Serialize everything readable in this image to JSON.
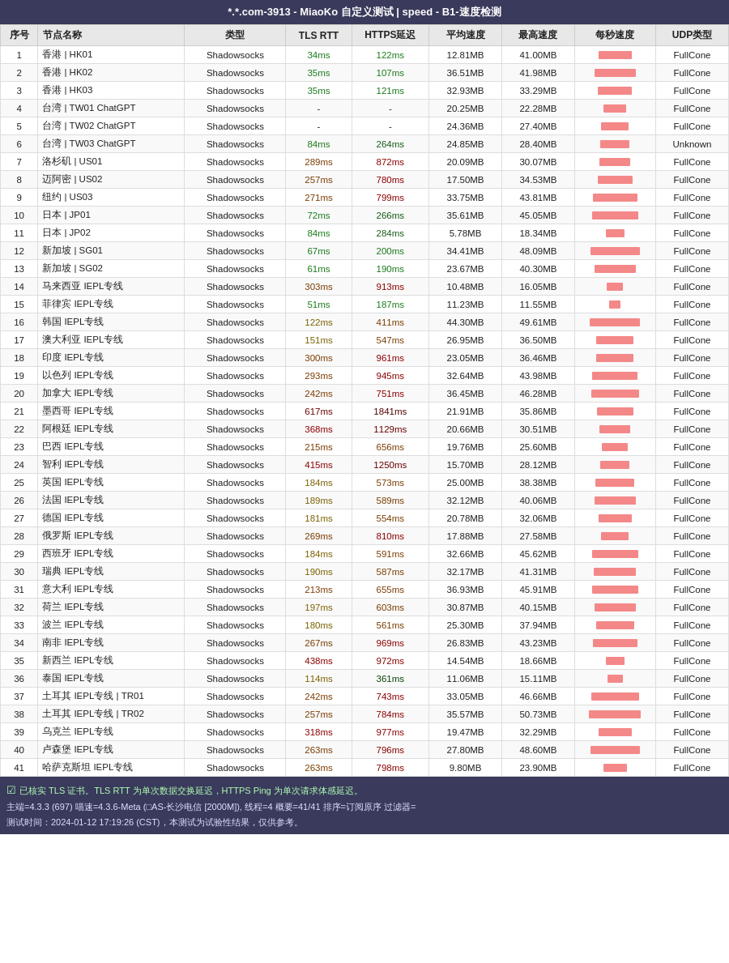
{
  "title": "*.*.com-3913 - MiaoKo 自定义测试 | speed - B1-速度检测",
  "columns": [
    "序号",
    "节点名称",
    "类型",
    "TLS RTT",
    "HTTPS延迟",
    "平均速度",
    "最高速度",
    "每秒速度",
    "UDP类型"
  ],
  "rows": [
    {
      "seq": 1,
      "name": "香港 | HK01",
      "type": "Shadowsocks",
      "tls": "34ms",
      "https": "122ms",
      "avg": "12.81MB",
      "max": "41.00MB",
      "udp": "FullCone",
      "bar": 32,
      "tls_cls": "green-light",
      "https_cls": "green-light"
    },
    {
      "seq": 2,
      "name": "香港 | HK02",
      "type": "Shadowsocks",
      "tls": "35ms",
      "https": "107ms",
      "avg": "36.51MB",
      "max": "41.98MB",
      "udp": "FullCone",
      "bar": 40,
      "tls_cls": "green-light",
      "https_cls": "green-light"
    },
    {
      "seq": 3,
      "name": "香港 | HK03",
      "type": "Shadowsocks",
      "tls": "35ms",
      "https": "121ms",
      "avg": "32.93MB",
      "max": "33.29MB",
      "udp": "FullCone",
      "bar": 33,
      "tls_cls": "green-light",
      "https_cls": "green-light"
    },
    {
      "seq": 4,
      "name": "台湾 | TW01 ChatGPT",
      "type": "Shadowsocks",
      "tls": "-",
      "https": "-",
      "avg": "20.25MB",
      "max": "22.28MB",
      "udp": "FullCone",
      "bar": 22,
      "tls_cls": "",
      "https_cls": ""
    },
    {
      "seq": 5,
      "name": "台湾 | TW02 ChatGPT",
      "type": "Shadowsocks",
      "tls": "-",
      "https": "-",
      "avg": "24.36MB",
      "max": "27.40MB",
      "udp": "FullCone",
      "bar": 27,
      "tls_cls": "",
      "https_cls": ""
    },
    {
      "seq": 6,
      "name": "台湾 | TW03 ChatGPT",
      "type": "Shadowsocks",
      "tls": "84ms",
      "https": "264ms",
      "avg": "24.85MB",
      "max": "28.40MB",
      "udp": "Unknown",
      "bar": 28,
      "tls_cls": "green-light",
      "https_cls": "green-med"
    },
    {
      "seq": 7,
      "name": "洛杉矶 | US01",
      "type": "Shadowsocks",
      "tls": "289ms",
      "https": "872ms",
      "avg": "20.09MB",
      "max": "30.07MB",
      "udp": "FullCone",
      "bar": 30,
      "tls_cls": "orange",
      "https_cls": "red-light"
    },
    {
      "seq": 8,
      "name": "迈阿密 | US02",
      "type": "Shadowsocks",
      "tls": "257ms",
      "https": "780ms",
      "avg": "17.50MB",
      "max": "34.53MB",
      "udp": "FullCone",
      "bar": 34,
      "tls_cls": "orange",
      "https_cls": "red-light"
    },
    {
      "seq": 9,
      "name": "纽约 | US03",
      "type": "Shadowsocks",
      "tls": "271ms",
      "https": "799ms",
      "avg": "33.75MB",
      "max": "43.81MB",
      "udp": "FullCone",
      "bar": 43,
      "tls_cls": "orange",
      "https_cls": "red-light"
    },
    {
      "seq": 10,
      "name": "日本 | JP01",
      "type": "Shadowsocks",
      "tls": "72ms",
      "https": "266ms",
      "avg": "35.61MB",
      "max": "45.05MB",
      "udp": "FullCone",
      "bar": 45,
      "tls_cls": "green-light",
      "https_cls": "green-med"
    },
    {
      "seq": 11,
      "name": "日本 | JP02",
      "type": "Shadowsocks",
      "tls": "84ms",
      "https": "284ms",
      "avg": "5.78MB",
      "max": "18.34MB",
      "udp": "FullCone",
      "bar": 18,
      "tls_cls": "green-light",
      "https_cls": "green-med"
    },
    {
      "seq": 12,
      "name": "新加坡 | SG01",
      "type": "Shadowsocks",
      "tls": "67ms",
      "https": "200ms",
      "avg": "34.41MB",
      "max": "48.09MB",
      "udp": "FullCone",
      "bar": 48,
      "tls_cls": "green-light",
      "https_cls": "green-light"
    },
    {
      "seq": 13,
      "name": "新加坡 | SG02",
      "type": "Shadowsocks",
      "tls": "61ms",
      "https": "190ms",
      "avg": "23.67MB",
      "max": "40.30MB",
      "udp": "FullCone",
      "bar": 40,
      "tls_cls": "green-light",
      "https_cls": "green-light"
    },
    {
      "seq": 14,
      "name": "马来西亚 IEPL专线",
      "type": "Shadowsocks",
      "tls": "303ms",
      "https": "913ms",
      "avg": "10.48MB",
      "max": "16.05MB",
      "udp": "FullCone",
      "bar": 16,
      "tls_cls": "orange",
      "https_cls": "red-light"
    },
    {
      "seq": 15,
      "name": "菲律宾 IEPL专线",
      "type": "Shadowsocks",
      "tls": "51ms",
      "https": "187ms",
      "avg": "11.23MB",
      "max": "11.55MB",
      "udp": "FullCone",
      "bar": 11,
      "tls_cls": "green-light",
      "https_cls": "green-light"
    },
    {
      "seq": 16,
      "name": "韩国 IEPL专线",
      "type": "Shadowsocks",
      "tls": "122ms",
      "https": "411ms",
      "avg": "44.30MB",
      "max": "49.61MB",
      "udp": "FullCone",
      "bar": 49,
      "tls_cls": "yellow-light",
      "https_cls": "orange"
    },
    {
      "seq": 17,
      "name": "澳大利亚 IEPL专线",
      "type": "Shadowsocks",
      "tls": "151ms",
      "https": "547ms",
      "avg": "26.95MB",
      "max": "36.50MB",
      "udp": "FullCone",
      "bar": 36,
      "tls_cls": "yellow-light",
      "https_cls": "orange"
    },
    {
      "seq": 18,
      "name": "印度 IEPL专线",
      "type": "Shadowsocks",
      "tls": "300ms",
      "https": "961ms",
      "avg": "23.05MB",
      "max": "36.46MB",
      "udp": "FullCone",
      "bar": 36,
      "tls_cls": "orange",
      "https_cls": "red-light"
    },
    {
      "seq": 19,
      "name": "以色列 IEPL专线",
      "type": "Shadowsocks",
      "tls": "293ms",
      "https": "945ms",
      "avg": "32.64MB",
      "max": "43.98MB",
      "udp": "FullCone",
      "bar": 44,
      "tls_cls": "orange",
      "https_cls": "red-light"
    },
    {
      "seq": 20,
      "name": "加拿大 IEPL专线",
      "type": "Shadowsocks",
      "tls": "242ms",
      "https": "751ms",
      "avg": "36.45MB",
      "max": "46.28MB",
      "udp": "FullCone",
      "bar": 46,
      "tls_cls": "orange",
      "https_cls": "red-light"
    },
    {
      "seq": 21,
      "name": "墨西哥 IEPL专线",
      "type": "Shadowsocks",
      "tls": "617ms",
      "https": "1841ms",
      "avg": "21.91MB",
      "max": "35.86MB",
      "udp": "FullCone",
      "bar": 35,
      "tls_cls": "red-med",
      "https_cls": "red-dark"
    },
    {
      "seq": 22,
      "name": "阿根廷 IEPL专线",
      "type": "Shadowsocks",
      "tls": "368ms",
      "https": "1129ms",
      "avg": "20.66MB",
      "max": "30.51MB",
      "udp": "FullCone",
      "bar": 30,
      "tls_cls": "red-light",
      "https_cls": "red-med"
    },
    {
      "seq": 23,
      "name": "巴西 IEPL专线",
      "type": "Shadowsocks",
      "tls": "215ms",
      "https": "656ms",
      "avg": "19.76MB",
      "max": "25.60MB",
      "udp": "FullCone",
      "bar": 25,
      "tls_cls": "orange",
      "https_cls": "orange"
    },
    {
      "seq": 24,
      "name": "智利 IEPL专线",
      "type": "Shadowsocks",
      "tls": "415ms",
      "https": "1250ms",
      "avg": "15.70MB",
      "max": "28.12MB",
      "udp": "FullCone",
      "bar": 28,
      "tls_cls": "red-light",
      "https_cls": "red-med"
    },
    {
      "seq": 25,
      "name": "英国 IEPL专线",
      "type": "Shadowsocks",
      "tls": "184ms",
      "https": "573ms",
      "avg": "25.00MB",
      "max": "38.38MB",
      "udp": "FullCone",
      "bar": 38,
      "tls_cls": "yellow-light",
      "https_cls": "orange"
    },
    {
      "seq": 26,
      "name": "法国 IEPL专线",
      "type": "Shadowsocks",
      "tls": "189ms",
      "https": "589ms",
      "avg": "32.12MB",
      "max": "40.06MB",
      "udp": "FullCone",
      "bar": 40,
      "tls_cls": "yellow-light",
      "https_cls": "orange"
    },
    {
      "seq": 27,
      "name": "德国 IEPL专线",
      "type": "Shadowsocks",
      "tls": "181ms",
      "https": "554ms",
      "avg": "20.78MB",
      "max": "32.06MB",
      "udp": "FullCone",
      "bar": 32,
      "tls_cls": "yellow-light",
      "https_cls": "orange"
    },
    {
      "seq": 28,
      "name": "俄罗斯 IEPL专线",
      "type": "Shadowsocks",
      "tls": "269ms",
      "https": "810ms",
      "avg": "17.88MB",
      "max": "27.58MB",
      "udp": "FullCone",
      "bar": 27,
      "tls_cls": "orange",
      "https_cls": "red-light"
    },
    {
      "seq": 29,
      "name": "西班牙 IEPL专线",
      "type": "Shadowsocks",
      "tls": "184ms",
      "https": "591ms",
      "avg": "32.66MB",
      "max": "45.62MB",
      "udp": "FullCone",
      "bar": 45,
      "tls_cls": "yellow-light",
      "https_cls": "orange"
    },
    {
      "seq": 30,
      "name": "瑞典 IEPL专线",
      "type": "Shadowsocks",
      "tls": "190ms",
      "https": "587ms",
      "avg": "32.17MB",
      "max": "41.31MB",
      "udp": "FullCone",
      "bar": 41,
      "tls_cls": "yellow-light",
      "https_cls": "orange"
    },
    {
      "seq": 31,
      "name": "意大利 IEPL专线",
      "type": "Shadowsocks",
      "tls": "213ms",
      "https": "655ms",
      "avg": "36.93MB",
      "max": "45.91MB",
      "udp": "FullCone",
      "bar": 45,
      "tls_cls": "orange",
      "https_cls": "orange"
    },
    {
      "seq": 32,
      "name": "荷兰 IEPL专线",
      "type": "Shadowsocks",
      "tls": "197ms",
      "https": "603ms",
      "avg": "30.87MB",
      "max": "40.15MB",
      "udp": "FullCone",
      "bar": 40,
      "tls_cls": "yellow-light",
      "https_cls": "orange"
    },
    {
      "seq": 33,
      "name": "波兰 IEPL专线",
      "type": "Shadowsocks",
      "tls": "180ms",
      "https": "561ms",
      "avg": "25.30MB",
      "max": "37.94MB",
      "udp": "FullCone",
      "bar": 37,
      "tls_cls": "yellow-light",
      "https_cls": "orange"
    },
    {
      "seq": 34,
      "name": "南非 IEPL专线",
      "type": "Shadowsocks",
      "tls": "267ms",
      "https": "969ms",
      "avg": "26.83MB",
      "max": "43.23MB",
      "udp": "FullCone",
      "bar": 43,
      "tls_cls": "orange",
      "https_cls": "red-light"
    },
    {
      "seq": 35,
      "name": "新西兰 IEPL专线",
      "type": "Shadowsocks",
      "tls": "438ms",
      "https": "972ms",
      "avg": "14.54MB",
      "max": "18.66MB",
      "udp": "FullCone",
      "bar": 18,
      "tls_cls": "red-light",
      "https_cls": "red-light"
    },
    {
      "seq": 36,
      "name": "泰国 IEPL专线",
      "type": "Shadowsocks",
      "tls": "114ms",
      "https": "361ms",
      "avg": "11.06MB",
      "max": "15.11MB",
      "udp": "FullCone",
      "bar": 15,
      "tls_cls": "yellow-light",
      "https_cls": "green-dark"
    },
    {
      "seq": 37,
      "name": "土耳其 IEPL专线 | TR01",
      "type": "Shadowsocks",
      "tls": "242ms",
      "https": "743ms",
      "avg": "33.05MB",
      "max": "46.66MB",
      "udp": "FullCone",
      "bar": 46,
      "tls_cls": "orange",
      "https_cls": "red-light"
    },
    {
      "seq": 38,
      "name": "土耳其 IEPL专线 | TR02",
      "type": "Shadowsocks",
      "tls": "257ms",
      "https": "784ms",
      "avg": "35.57MB",
      "max": "50.73MB",
      "udp": "FullCone",
      "bar": 50,
      "tls_cls": "orange",
      "https_cls": "red-light"
    },
    {
      "seq": 39,
      "name": "乌克兰 IEPL专线",
      "type": "Shadowsocks",
      "tls": "318ms",
      "https": "977ms",
      "avg": "19.47MB",
      "max": "32.29MB",
      "udp": "FullCone",
      "bar": 32,
      "tls_cls": "red-light",
      "https_cls": "red-light"
    },
    {
      "seq": 40,
      "name": "卢森堡 IEPL专线",
      "type": "Shadowsocks",
      "tls": "263ms",
      "https": "796ms",
      "avg": "27.80MB",
      "max": "48.60MB",
      "udp": "FullCone",
      "bar": 48,
      "tls_cls": "orange",
      "https_cls": "red-light"
    },
    {
      "seq": 41,
      "name": "哈萨克斯坦 IEPL专线",
      "type": "Shadowsocks",
      "tls": "263ms",
      "https": "798ms",
      "avg": "9.80MB",
      "max": "23.90MB",
      "udp": "FullCone",
      "bar": 23,
      "tls_cls": "orange",
      "https_cls": "red-light"
    }
  ],
  "footer": {
    "checkbox_label": "已核实 TLS 证书。TLS RTT 为单次数据交换延迟，HTTPS Ping 为单次请求体感延迟。",
    "line1": "主端=4.3.3 (697) 喵速=4.3.6-Meta (□AS-长沙电信 [2000M]), 线程=4 概要=41/41 排序=订阅原序 过滤器=",
    "line2": "测试时间：2024-01-12 17:19:26 (CST)，本测试为试验性结果，仅供参考。"
  }
}
